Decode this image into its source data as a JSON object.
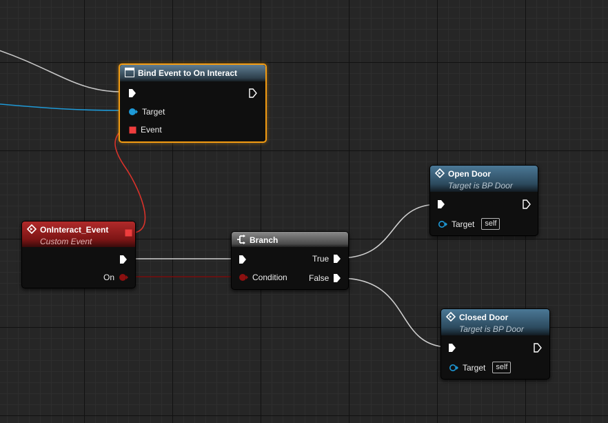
{
  "nodes": {
    "bind_event": {
      "title": "Bind Event to On Interact",
      "pins": {
        "target": "Target",
        "event": "Event"
      }
    },
    "custom_event": {
      "title": "OnInteract_Event",
      "subtitle": "Custom Event",
      "pins": {
        "on": "On"
      }
    },
    "branch": {
      "title": "Branch",
      "pins": {
        "condition": "Condition",
        "true": "True",
        "false": "False"
      }
    },
    "open_door": {
      "title": "Open Door",
      "subtitle": "Target is BP Door",
      "pins": {
        "target": "Target",
        "self": "self"
      }
    },
    "closed_door": {
      "title": "Closed Door",
      "subtitle": "Target is BP Door",
      "pins": {
        "target": "Target",
        "self": "self"
      }
    }
  },
  "colors": {
    "exec_wire": "#d0d0d0",
    "object_wire": "#1e9ad8",
    "delegate_wire": "#d9322a",
    "bool_wire": "#7a0b0b",
    "selection": "#f39c12",
    "custom_event_header": "#8e1c1c",
    "function_header": "#3c6a87",
    "branch_header": "#707070"
  },
  "icons": {
    "bind_event": "event-dispatcher-icon",
    "custom_event": "event-diamond-icon",
    "branch": "branch-icon",
    "function": "function-diamond-icon"
  }
}
